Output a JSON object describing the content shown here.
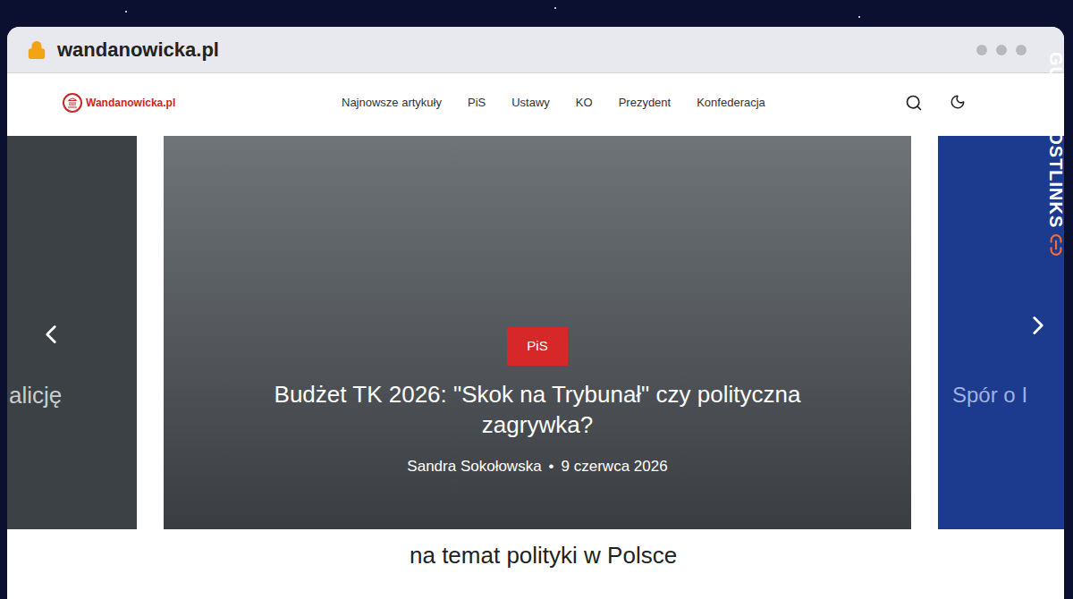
{
  "browser": {
    "url": "wandanowicka.pl"
  },
  "site": {
    "logo": "Wandanowicka.pl",
    "nav": [
      {
        "label": "Najnowsze artykuły"
      },
      {
        "label": "PiS"
      },
      {
        "label": "Ustawy"
      },
      {
        "label": "KO"
      },
      {
        "label": "Prezydent"
      },
      {
        "label": "Konfederacja"
      }
    ]
  },
  "carousel": {
    "prev_slide": {
      "title": "alicję"
    },
    "current_slide": {
      "category": "PiS",
      "title": "Budżet TK 2026: \"Skok na Trybunał\" czy polityczna zagrywka?",
      "author": "Sandra Sokołowska",
      "separator": "•",
      "date": "9 czerwca 2026"
    },
    "next_slide": {
      "title": "Spór o I"
    }
  },
  "section_heading": "na temat polityki w Polsce",
  "watermark": "GUESTPOSTLINKS"
}
